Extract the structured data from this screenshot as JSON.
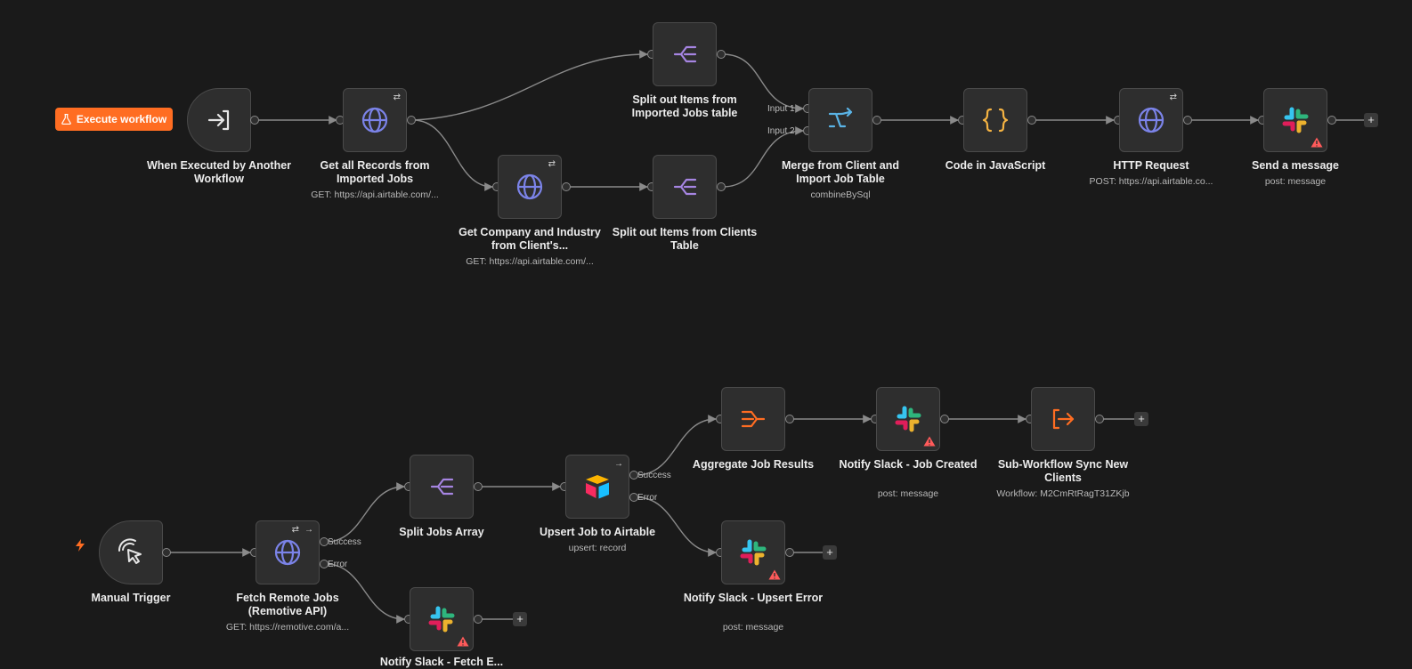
{
  "execute_button": {
    "label": "Execute workflow"
  },
  "colors": {
    "accent": "#ff6d22",
    "http": "#7b83e8",
    "split": "#a685e2",
    "merge": "#5ab4e6",
    "code": "#f5b342",
    "aggregate": "#ff6d22",
    "warning": "#ff5a5a"
  },
  "nodes": {
    "exec_trigger": {
      "label": "When Executed by Another Workflow",
      "sub": "",
      "icon": "sign-in-icon"
    },
    "get_records": {
      "label": "Get all Records from Imported Jobs",
      "sub": "GET: https://api.airtable.com/...",
      "icon": "globe-icon"
    },
    "split_imported": {
      "label": "Split out Items from Imported Jobs table",
      "sub": "",
      "icon": "split-icon"
    },
    "get_company": {
      "label": "Get Company and Industry from Client's...",
      "sub": "GET: https://api.airtable.com/...",
      "icon": "globe-icon"
    },
    "split_clients": {
      "label": "Split out Items from Clients Table",
      "sub": "",
      "icon": "split-icon"
    },
    "merge": {
      "label": "Merge from Client and Import Job Table",
      "sub": "combineBySql",
      "icon": "merge-icon",
      "input1": "Input 1",
      "input2": "Input 2"
    },
    "code_js": {
      "label": "Code in JavaScript",
      "sub": "",
      "icon": "code-braces-icon"
    },
    "http_request": {
      "label": "HTTP Request",
      "sub": "POST: https://api.airtable.co...",
      "icon": "globe-icon"
    },
    "send_message": {
      "label": "Send a message",
      "sub": "post: message",
      "icon": "slack-icon"
    },
    "manual_trigger": {
      "label": "Manual Trigger",
      "sub": "",
      "icon": "pointer-click-icon"
    },
    "fetch_remote": {
      "label": "Fetch Remote Jobs (Remotive API)",
      "sub": "GET: https://remotive.com/a...",
      "icon": "globe-icon",
      "out_success": "Success",
      "out_error": "Error"
    },
    "split_jobs": {
      "label": "Split Jobs Array",
      "sub": "",
      "icon": "split-icon"
    },
    "notify_fetch": {
      "label": "Notify Slack - Fetch E...",
      "sub": "",
      "icon": "slack-icon"
    },
    "upsert": {
      "label": "Upsert Job to Airtable",
      "sub": "upsert: record",
      "icon": "airtable-icon",
      "out_success": "Success",
      "out_error": "Error"
    },
    "aggregate": {
      "label": "Aggregate Job Results",
      "sub": "",
      "icon": "aggregate-icon"
    },
    "notify_job": {
      "label": "Notify Slack - Job Created",
      "sub": "post: message",
      "icon": "slack-icon"
    },
    "subworkflow": {
      "label": "Sub-Workflow Sync New Clients",
      "sub": "Workflow: M2CmRtRagT31ZKjb",
      "icon": "sign-out-icon"
    },
    "notify_upsert": {
      "label": "Notify Slack - Upsert Error",
      "sub": "post: message",
      "icon": "slack-icon"
    }
  },
  "plus_label": "+"
}
